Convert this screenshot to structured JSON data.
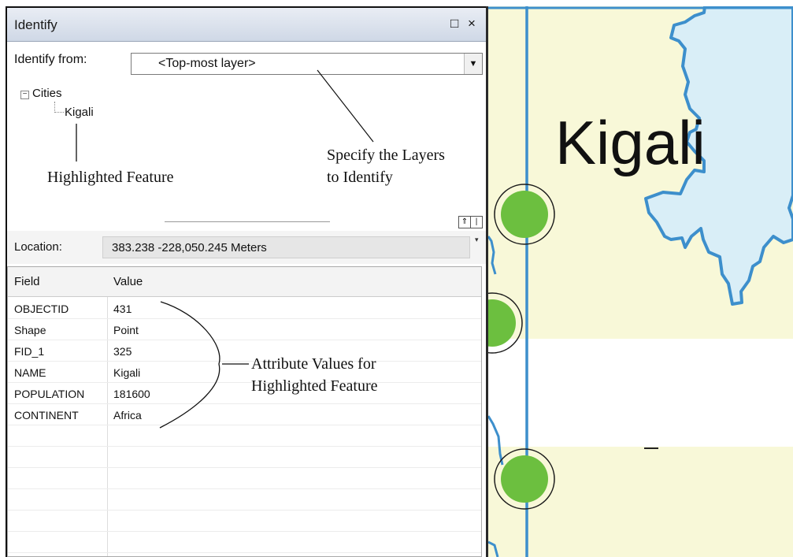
{
  "panel": {
    "title": "Identify",
    "restore_glyph": "□",
    "close_glyph": "×",
    "identify_from_label": "Identify from:",
    "identify_from_value": "<Top-most layer>",
    "dropdown_glyph": "▼"
  },
  "tree": {
    "collapse_glyph": "−",
    "layer": "Cities",
    "feature": "Kigali"
  },
  "annotations": {
    "highlighted_feature": "Highlighted Feature",
    "specify_line1": "Specify the Layers",
    "specify_line2": "to Identify",
    "attr_line1": "Attribute Values for",
    "attr_line2": "Highlighted Feature"
  },
  "splitter": {
    "expand_glyph": "⇑",
    "pane_glyph": "|"
  },
  "location": {
    "label": "Location:",
    "value": "383.238  -228,050.245 Meters",
    "pin_glyph": "▾"
  },
  "attributes": {
    "columns": {
      "field": "Field",
      "value": "Value"
    },
    "rows": [
      {
        "field": "OBJECTID",
        "value": "431"
      },
      {
        "field": "Shape",
        "value": "Point"
      },
      {
        "field": "FID_1",
        "value": "325"
      },
      {
        "field": "NAME",
        "value": "Kigali"
      },
      {
        "field": "POPULATION",
        "value": "181600"
      },
      {
        "field": "CONTINENT",
        "value": "Africa"
      },
      {
        "field": "",
        "value": ""
      },
      {
        "field": "",
        "value": ""
      },
      {
        "field": "",
        "value": ""
      },
      {
        "field": "",
        "value": ""
      },
      {
        "field": "",
        "value": ""
      },
      {
        "field": "",
        "value": ""
      }
    ]
  },
  "map": {
    "city_label": "Kigali",
    "colors": {
      "land": "#f8f8d8",
      "water": "#d9eef7",
      "border": "#3d8fcc",
      "city_symbol": "#6cbf3f"
    }
  }
}
